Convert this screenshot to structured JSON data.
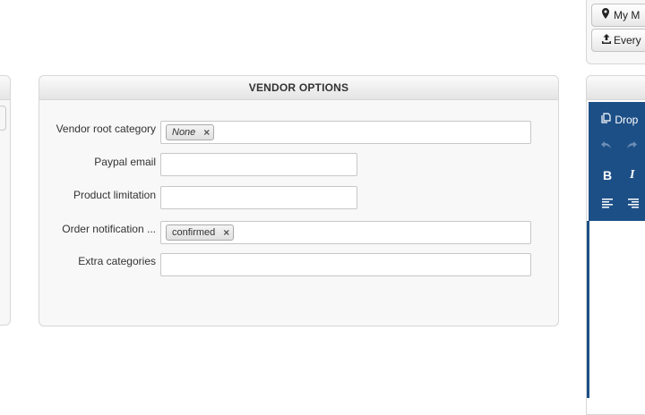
{
  "panel": {
    "title": "VENDOR OPTIONS",
    "fields": [
      {
        "label": "Vendor root category",
        "tag": "None",
        "tag_remove": "×"
      },
      {
        "label": "Paypal email",
        "value": ""
      },
      {
        "label": "Product limitation",
        "value": ""
      },
      {
        "label": "Order notification ...",
        "tag": "confirmed",
        "tag_remove": "×"
      },
      {
        "label": "Extra categories",
        "value": ""
      }
    ]
  },
  "top_buttons": [
    {
      "icon": "map-marker-icon",
      "label": "My M"
    },
    {
      "icon": "upload-icon",
      "label": "Every"
    }
  ],
  "editor": {
    "dropdown_label": "Drop",
    "bold": "B",
    "italic": "I"
  },
  "colors": {
    "toolbar_bg": "#1d4f87",
    "panel_bg": "#f8f8f8",
    "border": "#d7d7d7"
  }
}
